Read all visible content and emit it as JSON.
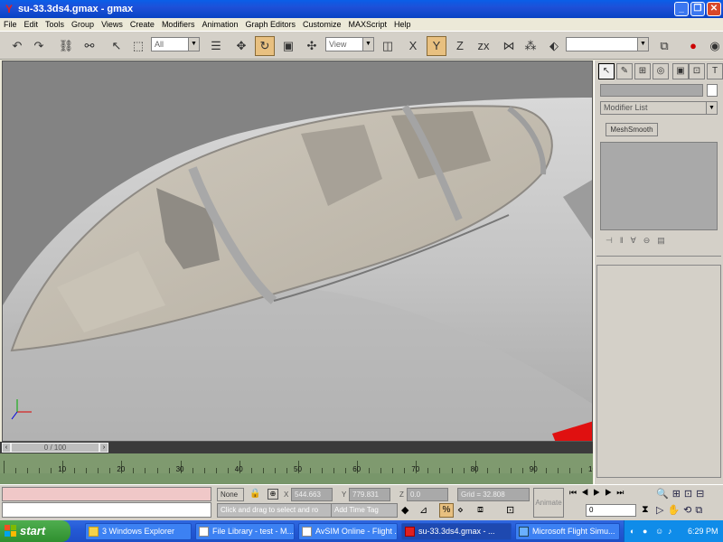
{
  "window": {
    "title": "su-33.3ds4.gmax - gmax"
  },
  "menu": [
    "File",
    "Edit",
    "Tools",
    "Group",
    "Views",
    "Create",
    "Modifiers",
    "Animation",
    "Graph Editors",
    "Customize",
    "MAXScript",
    "Help"
  ],
  "toolbar": {
    "selection_filter": "All",
    "reference_coord": "View"
  },
  "command_panel": {
    "object_name": "",
    "modifier_list": "Modifier List",
    "modifier_stack": [
      "MeshSmooth"
    ]
  },
  "time_slider": {
    "label": "0 / 100"
  },
  "track_ruler": {
    "labels": [
      "10",
      "20",
      "30",
      "40",
      "50",
      "60",
      "70",
      "80",
      "90",
      "10"
    ]
  },
  "status": {
    "none_selected": "None",
    "x_label": "X",
    "x_value": "544.663",
    "y_label": "Y",
    "y_value": "779.831",
    "z_label": "Z",
    "z_value": "0.0",
    "grid": "Grid = 32.808",
    "prompt": "Click and drag to select and ro",
    "add_time_tag": "Add Time Tag",
    "animate_label": "Animate",
    "frame_value": "0"
  },
  "taskbar": {
    "start": "start",
    "tasks": [
      {
        "label": "3 Windows Explorer"
      },
      {
        "label": "File Library - test - M..."
      },
      {
        "label": "AvSIM Online - Flight ..."
      },
      {
        "label": "su-33.3ds4.gmax - ..."
      },
      {
        "label": "Microsoft Flight Simu..."
      }
    ],
    "clock": "6:29 PM"
  },
  "colors": {
    "titlebar": "#1e50d8",
    "viewport_bg": "#808080",
    "trackbar": "#7f9a6f",
    "taskbar": "#245ad6",
    "start_button": "#3c9a3c"
  }
}
